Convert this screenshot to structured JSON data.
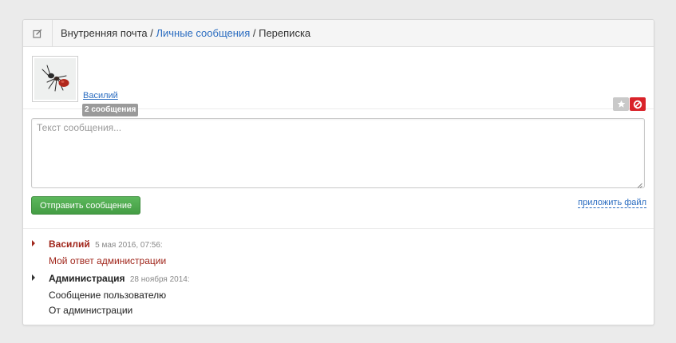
{
  "header": {
    "crumb_root": "Внутренняя почта",
    "separator": "/",
    "crumb_link": "Личные сообщения",
    "crumb_current": "Переписка"
  },
  "contact": {
    "name": "Василий",
    "badge": "2 сообщения"
  },
  "composer": {
    "placeholder": "Текст сообщения...",
    "send_label": "Отправить сообщение",
    "attach_label": "приложить файл"
  },
  "messages": [
    {
      "author": "Василий",
      "date": "5 мая 2016, 07:56:",
      "lines": [
        "Мой ответ администрации"
      ]
    },
    {
      "author": "Администрация",
      "date": "28 ноября 2014:",
      "lines": [
        "Сообщение пользователю",
        "От администрации"
      ]
    }
  ],
  "colors": {
    "link": "#2a6cc0",
    "user_message": "#a0261b",
    "send_button": "#4cae4c",
    "block_button": "#d9232a"
  },
  "icons": {
    "header": "edit-icon",
    "star": "star-icon",
    "block": "block-icon"
  }
}
